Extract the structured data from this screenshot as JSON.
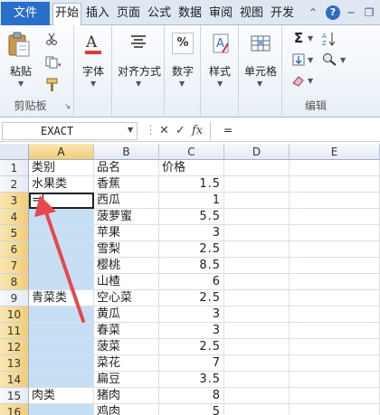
{
  "tabs": {
    "file": "文件",
    "items": [
      "开始",
      "插入",
      "页面",
      "公式",
      "数据",
      "审阅",
      "视图",
      "开发"
    ],
    "active_index": 0
  },
  "ribbon": {
    "clipboard": {
      "paste": "粘贴",
      "group": "剪贴板"
    },
    "font": {
      "label": "字体"
    },
    "alignment": {
      "label": "对齐方式"
    },
    "number": {
      "label": "数字",
      "symbol": "%"
    },
    "styles": {
      "label": "样式"
    },
    "cells": {
      "label": "单元格"
    },
    "editing": {
      "group": "编辑",
      "sigma": "Σ"
    }
  },
  "formula_bar": {
    "name_box": "EXACT",
    "cancel": "✕",
    "enter": "✓",
    "fx": "fx",
    "value": "="
  },
  "columns": [
    "A",
    "B",
    "C",
    "D",
    "E"
  ],
  "rows": [
    {
      "n": "1",
      "a": "类别",
      "b": "品名",
      "c": "价格"
    },
    {
      "n": "2",
      "a": "水果类",
      "b": "香蕉",
      "c": "1.5"
    },
    {
      "n": "3",
      "a": "=",
      "b": "西瓜",
      "c": "1"
    },
    {
      "n": "4",
      "a": "",
      "b": "菠萝蜜",
      "c": "5.5"
    },
    {
      "n": "5",
      "a": "",
      "b": "苹果",
      "c": "3"
    },
    {
      "n": "6",
      "a": "",
      "b": "雪梨",
      "c": "2.5"
    },
    {
      "n": "7",
      "a": "",
      "b": "樱桃",
      "c": "8.5"
    },
    {
      "n": "8",
      "a": "",
      "b": "山楂",
      "c": "6"
    },
    {
      "n": "9",
      "a": "青菜类",
      "b": "空心菜",
      "c": "2.5"
    },
    {
      "n": "10",
      "a": "",
      "b": "黄瓜",
      "c": "3"
    },
    {
      "n": "11",
      "a": "",
      "b": "春菜",
      "c": "3"
    },
    {
      "n": "12",
      "a": "",
      "b": "菠菜",
      "c": "2.5"
    },
    {
      "n": "13",
      "a": "",
      "b": "菜花",
      "c": "7"
    },
    {
      "n": "14",
      "a": "",
      "b": "扁豆",
      "c": "3.5"
    },
    {
      "n": "15",
      "a": "肉类",
      "b": "猪肉",
      "c": "8"
    },
    {
      "n": "16",
      "a": "",
      "b": "鸡肉",
      "c": "5"
    }
  ],
  "colors": {
    "selection": "#c7dff5",
    "arrow": "#e8474c",
    "file_tab": "#2a6fc9"
  }
}
